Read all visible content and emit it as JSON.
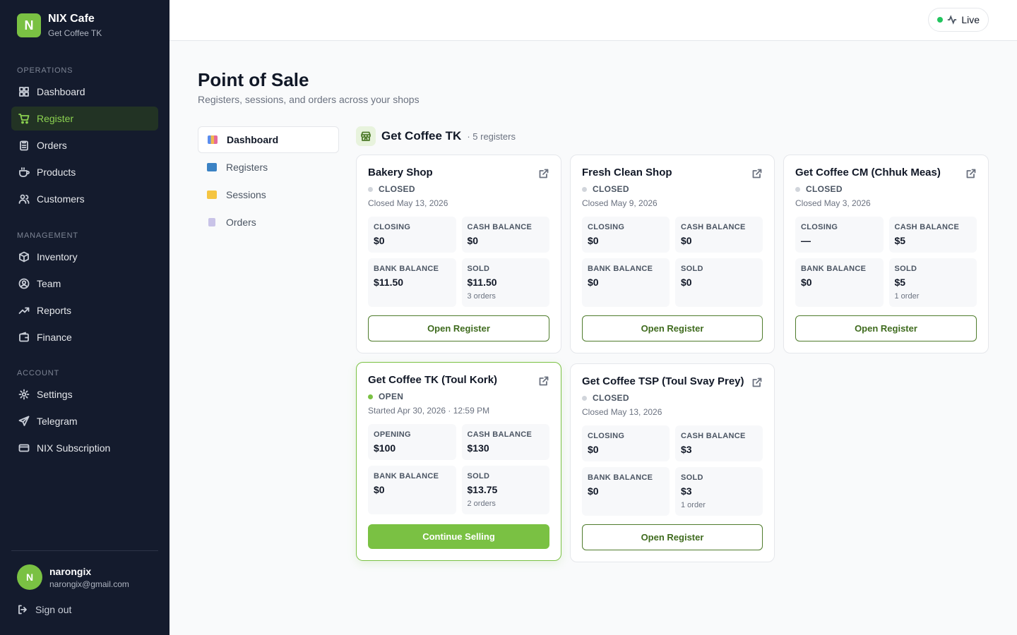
{
  "brand": {
    "initial": "N",
    "name": "NIX Cafe",
    "sub": "Get Coffee TK"
  },
  "nav": {
    "operations_heading": "OPERATIONS",
    "operations": [
      "Dashboard",
      "Register",
      "Orders",
      "Products",
      "Customers"
    ],
    "management_heading": "MANAGEMENT",
    "management": [
      "Inventory",
      "Team",
      "Reports",
      "Finance"
    ],
    "account_heading": "ACCOUNT",
    "account": [
      "Settings",
      "Telegram",
      "NIX Subscription"
    ]
  },
  "user": {
    "initial": "N",
    "name": "narongix",
    "email": "narongix@gmail.com",
    "signout": "Sign out"
  },
  "topbar": {
    "live": "Live"
  },
  "page": {
    "title": "Point of Sale",
    "subtitle": "Registers, sessions, and orders across your shops"
  },
  "subnav": [
    "Dashboard",
    "Registers",
    "Sessions",
    "Orders"
  ],
  "shop": {
    "name": "Get Coffee TK",
    "count": "· 5 registers"
  },
  "registers": [
    {
      "name": "Bakery Shop",
      "status": "CLOSED",
      "date": "Closed May 13, 2026",
      "s1_label": "CLOSING",
      "s1_value": "$0",
      "s2_label": "CASH BALANCE",
      "s2_value": "$0",
      "s3_label": "BANK BALANCE",
      "s3_value": "$11.50",
      "s4_label": "SOLD",
      "s4_value": "$11.50",
      "s4_note": "3 orders",
      "button": "Open Register"
    },
    {
      "name": "Fresh Clean Shop",
      "status": "CLOSED",
      "date": "Closed May 9, 2026",
      "s1_label": "CLOSING",
      "s1_value": "$0",
      "s2_label": "CASH BALANCE",
      "s2_value": "$0",
      "s3_label": "BANK BALANCE",
      "s3_value": "$0",
      "s4_label": "SOLD",
      "s4_value": "$0",
      "s4_note": "",
      "button": "Open Register"
    },
    {
      "name": "Get Coffee CM (Chhuk Meas)",
      "status": "CLOSED",
      "date": "Closed May 3, 2026",
      "s1_label": "CLOSING",
      "s1_value": "—",
      "s2_label": "CASH BALANCE",
      "s2_value": "$5",
      "s3_label": "BANK BALANCE",
      "s3_value": "$0",
      "s4_label": "SOLD",
      "s4_value": "$5",
      "s4_note": "1 order",
      "button": "Open Register"
    },
    {
      "name": "Get Coffee TK (Toul Kork)",
      "status": "OPEN",
      "date": "Started Apr 30, 2026 · 12:59 PM",
      "s1_label": "OPENING",
      "s1_value": "$100",
      "s2_label": "CASH BALANCE",
      "s2_value": "$130",
      "s3_label": "BANK BALANCE",
      "s3_value": "$0",
      "s4_label": "SOLD",
      "s4_value": "$13.75",
      "s4_note": "2 orders",
      "button": "Continue Selling"
    },
    {
      "name": "Get Coffee TSP (Toul Svay Prey)",
      "status": "CLOSED",
      "date": "Closed May 13, 2026",
      "s1_label": "CLOSING",
      "s1_value": "$0",
      "s2_label": "CASH BALANCE",
      "s2_value": "$3",
      "s3_label": "BANK BALANCE",
      "s3_value": "$0",
      "s4_label": "SOLD",
      "s4_value": "$3",
      "s4_note": "1 order",
      "button": "Open Register"
    }
  ]
}
